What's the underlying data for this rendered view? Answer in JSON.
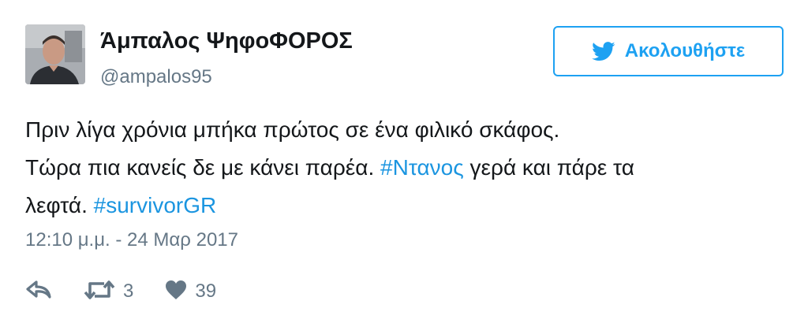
{
  "user": {
    "display_name": "Άμπαλος ΨηφοΦΟΡΟΣ",
    "handle": "@ampalos95"
  },
  "follow_button": {
    "label": "Ακολουθήστε",
    "icon": "twitter-bird-icon"
  },
  "tweet": {
    "line1": "Πριν λίγα χρόνια μπήκα πρώτος σε ένα φιλικό σκάφος.",
    "line2_before": "Τώρα πια κανείς δε με κάνει παρέα. ",
    "hashtag1": "#Ντανος",
    "line2_after": " γερά και πάρε τα",
    "line3_before": "λεφτά. ",
    "hashtag2": "#survivorGR"
  },
  "timestamp": "12:10 μ.μ. - 24 Μαρ 2017",
  "actions": {
    "reply_icon": "reply-icon",
    "retweet_icon": "retweet-icon",
    "retweet_count": "3",
    "like_icon": "heart-icon",
    "like_count": "39"
  },
  "colors": {
    "accent": "#1da1f2",
    "hashtag": "#1b95e0",
    "secondary_text": "#657786",
    "primary_text": "#14171a"
  }
}
